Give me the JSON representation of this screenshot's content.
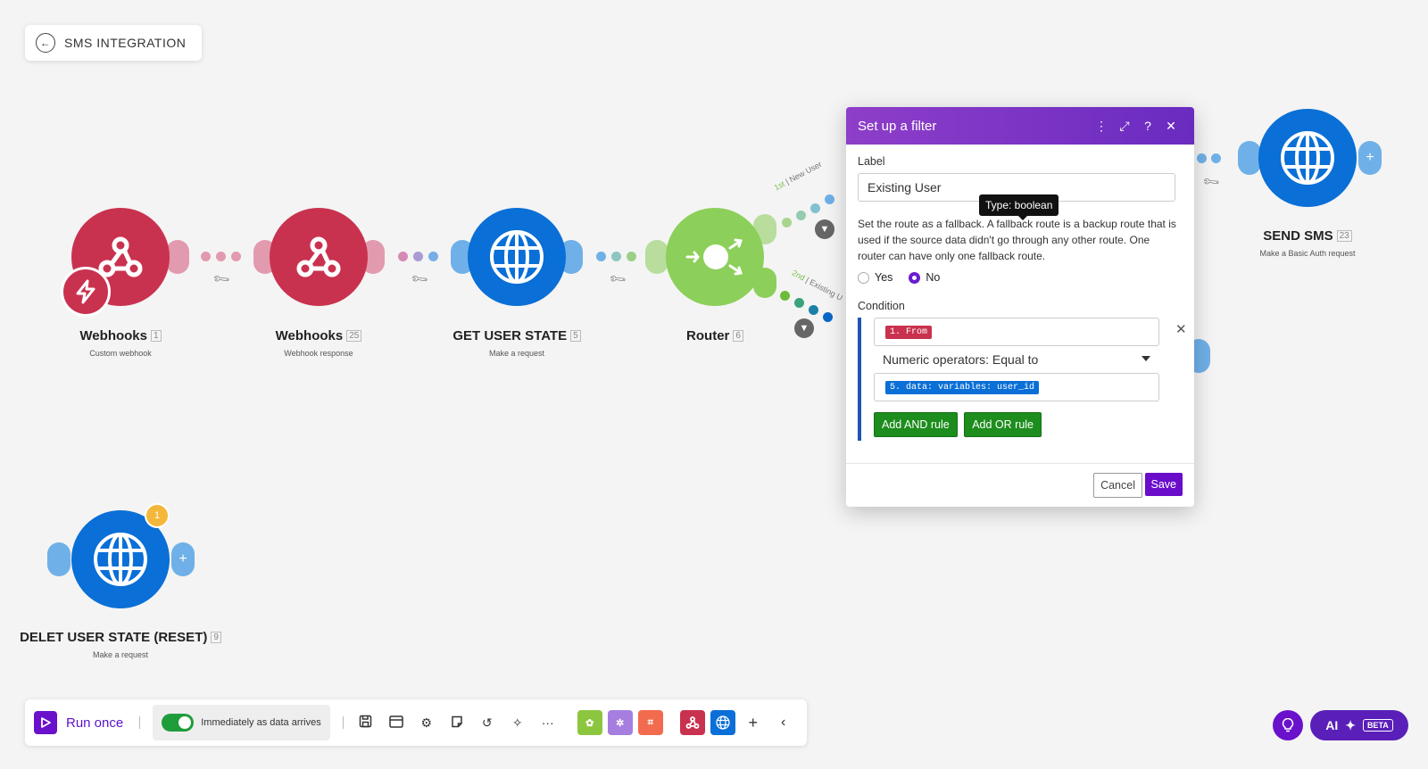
{
  "scenario": {
    "title": "SMS INTEGRATION"
  },
  "modules": [
    {
      "name": "Webhooks",
      "id": "1",
      "subtitle": "Custom webhook",
      "color": "#c9324f",
      "icon": "webhook-icon"
    },
    {
      "name": "Webhooks",
      "id": "25",
      "subtitle": "Webhook response",
      "color": "#c9324f",
      "icon": "webhook-icon"
    },
    {
      "name": "GET USER STATE",
      "id": "5",
      "subtitle": "Make a request",
      "color": "#0a6fd6",
      "icon": "globe-icon"
    },
    {
      "name": "Router",
      "id": "6",
      "subtitle": "",
      "color": "#8ccf5a",
      "icon": "router-icon"
    },
    {
      "name": "SEND SMS",
      "id": "23",
      "subtitle": "Make a Basic Auth request",
      "color": "#0a6fd6",
      "icon": "globe-icon"
    },
    {
      "name": "DELET USER STATE (RESET)",
      "id": "9",
      "subtitle": "Make a request",
      "color": "#0a6fd6",
      "icon": "globe-icon",
      "badge": "1"
    }
  ],
  "routes": [
    {
      "order": "1st",
      "label": "New User"
    },
    {
      "order": "2nd",
      "label": "Existing U"
    }
  ],
  "dialog": {
    "title": "Set up a filter",
    "label_heading": "Label",
    "label_value": "Existing User",
    "tooltip": "Type: boolean",
    "fallback_text": "Set the route as a fallback. A fallback route is a backup route that is used if the source data didn't go through any other route. One router can have only one fallback route.",
    "yes": "Yes",
    "no": "No",
    "fallback_selected": "No",
    "condition_heading": "Condition",
    "operand1": "1. From",
    "operator": "Numeric operators: Equal to",
    "operand2": "5. data: variables: user_id",
    "add_and": "Add AND rule",
    "add_or": "Add OR rule",
    "cancel": "Cancel",
    "save": "Save"
  },
  "toolbar": {
    "run_once": "Run once",
    "schedule": "Immediately as data arrives",
    "schedule_on": true
  },
  "ai": {
    "label": "AI",
    "beta": "BETA"
  },
  "colors": {
    "accent": "#6a11cb",
    "webhook": "#c9324f",
    "http": "#0a6fd6",
    "router": "#8ccf5a",
    "green": "#1d8d1d"
  }
}
